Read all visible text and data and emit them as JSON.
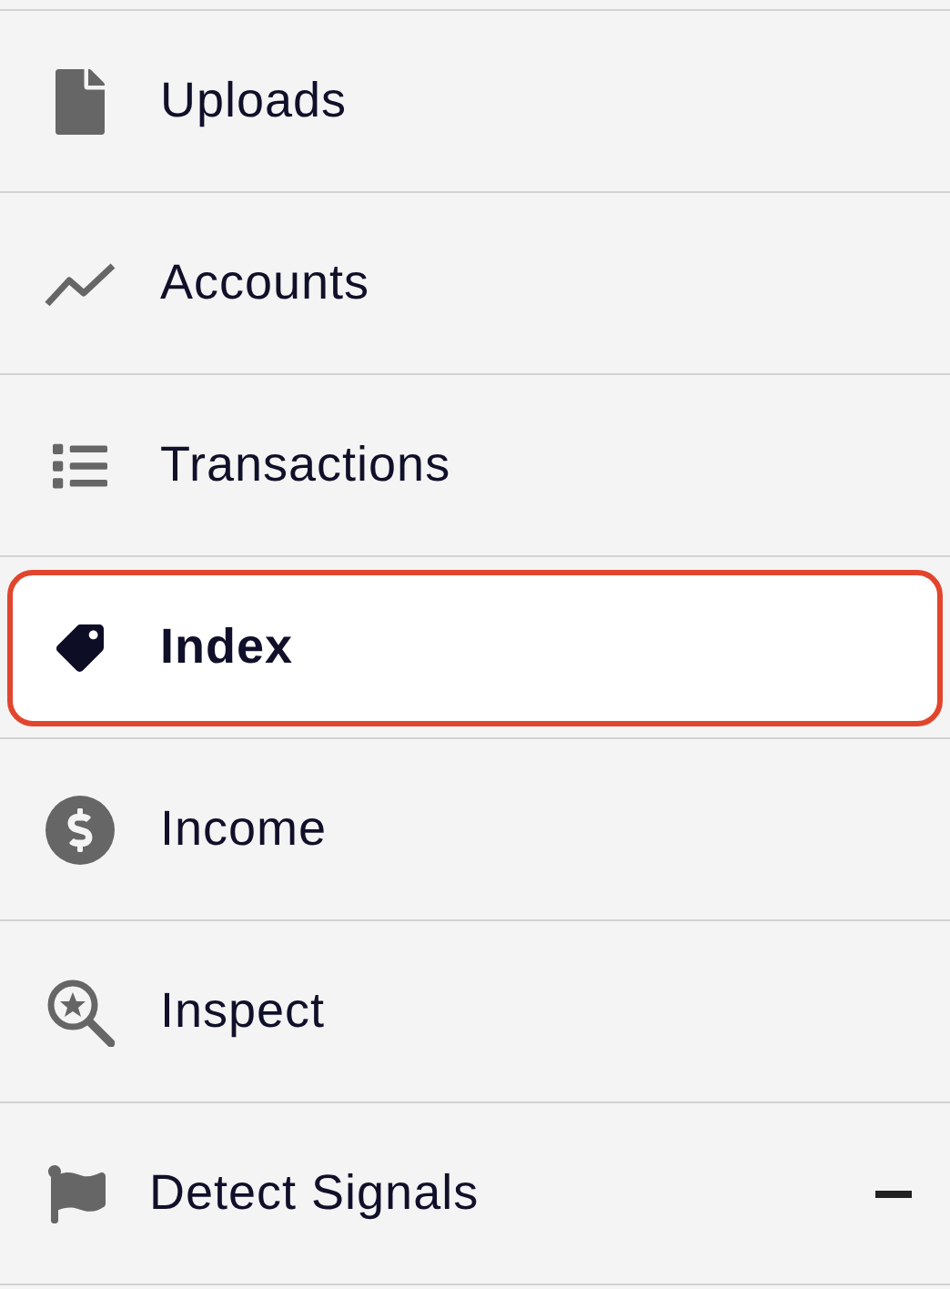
{
  "menu": {
    "items": [
      {
        "label": "Uploads",
        "selected": false,
        "kind": "link"
      },
      {
        "label": "Accounts",
        "selected": false,
        "kind": "link"
      },
      {
        "label": "Transactions",
        "selected": false,
        "kind": "link"
      },
      {
        "label": "Index",
        "selected": true,
        "kind": "link"
      },
      {
        "label": "Income",
        "selected": false,
        "kind": "link"
      },
      {
        "label": "Inspect",
        "selected": false,
        "kind": "link"
      },
      {
        "label": "Detect Signals",
        "selected": false,
        "kind": "group",
        "expanded": true
      }
    ]
  }
}
